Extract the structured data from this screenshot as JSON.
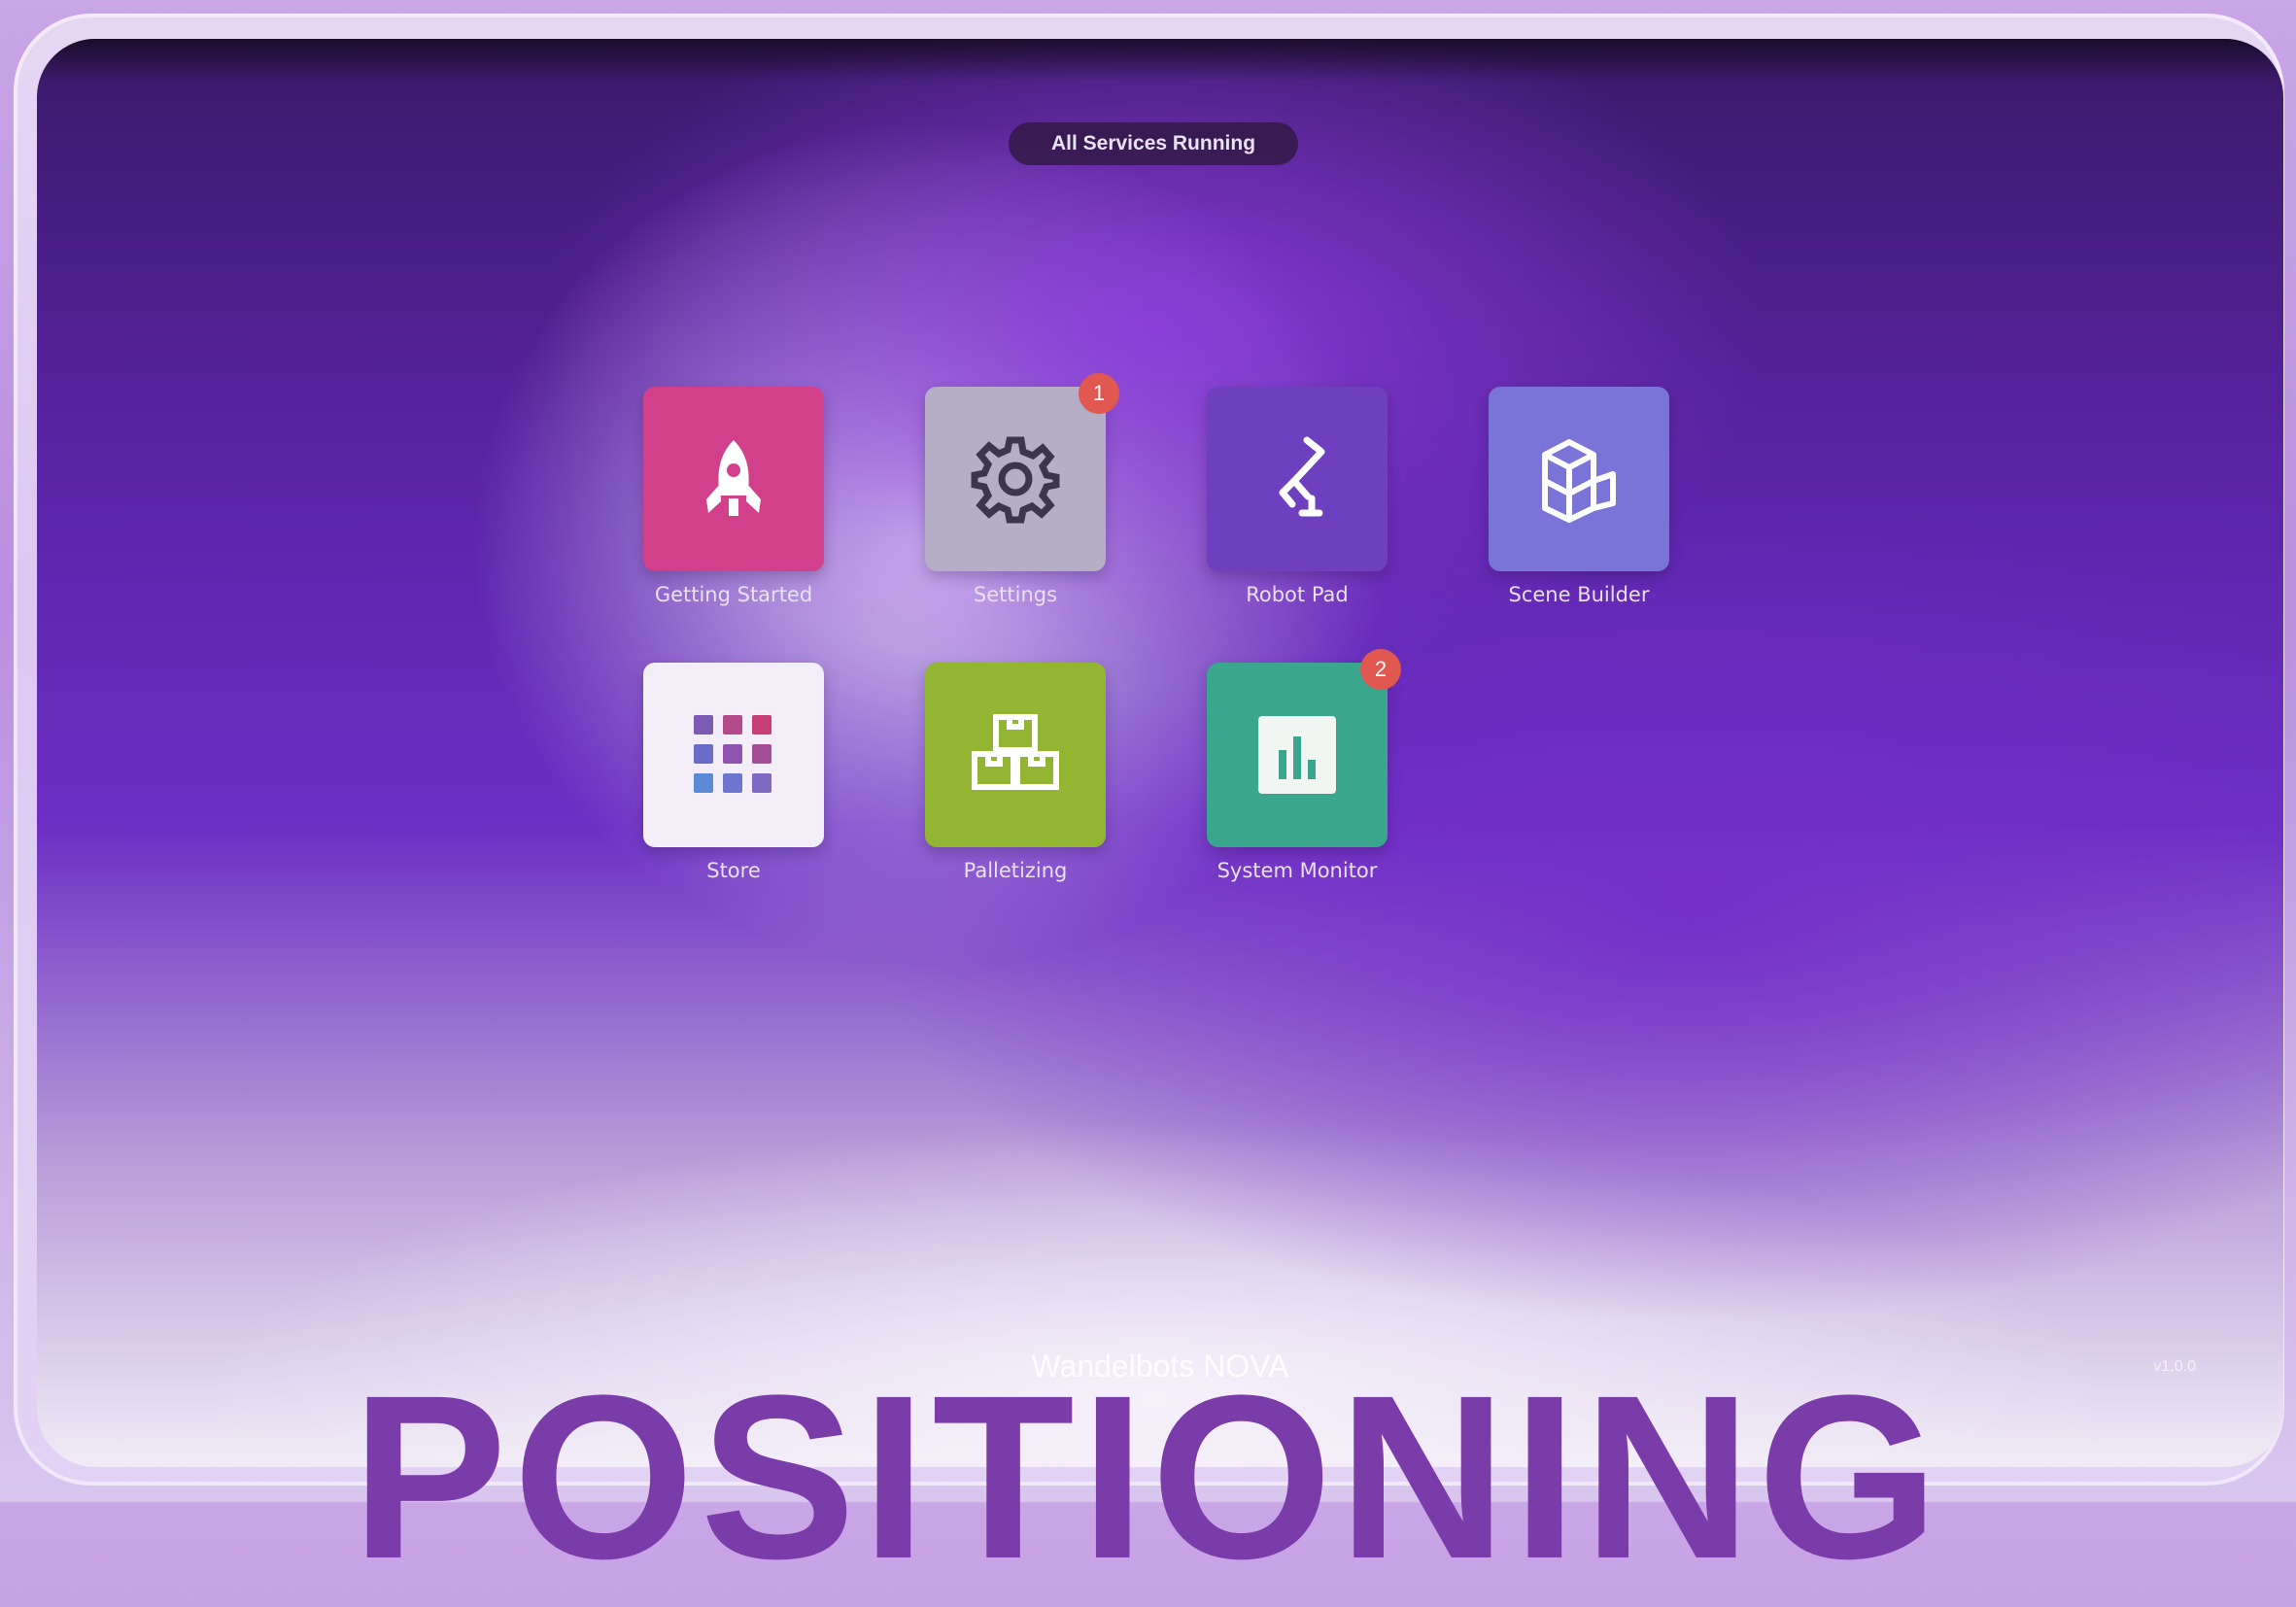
{
  "status": {
    "text": "All Services Running"
  },
  "apps": [
    {
      "label": "Getting Started",
      "icon": "rocket-icon",
      "color": "#d23f8a",
      "badge": ""
    },
    {
      "label": "Settings",
      "icon": "gear-icon",
      "color": "#b6adc6",
      "badge": "1"
    },
    {
      "label": "Robot Pad",
      "icon": "robot-arm-icon",
      "color": "#6e3fbf",
      "badge": ""
    },
    {
      "label": "Scene Builder",
      "icon": "cubes-icon",
      "color": "#7a74d8",
      "badge": ""
    },
    {
      "label": "Store",
      "icon": "grid-icon",
      "color": "#f4eef8",
      "badge": ""
    },
    {
      "label": "Palletizing",
      "icon": "boxes-icon",
      "color": "#93b632",
      "badge": ""
    },
    {
      "label": "System Monitor",
      "icon": "chart-icon",
      "color": "#3aa68e",
      "badge": "2"
    }
  ],
  "footer": {
    "brand": "Wandelbots NOVA",
    "right": "v1.0.0"
  },
  "headline": "POSITIONING"
}
